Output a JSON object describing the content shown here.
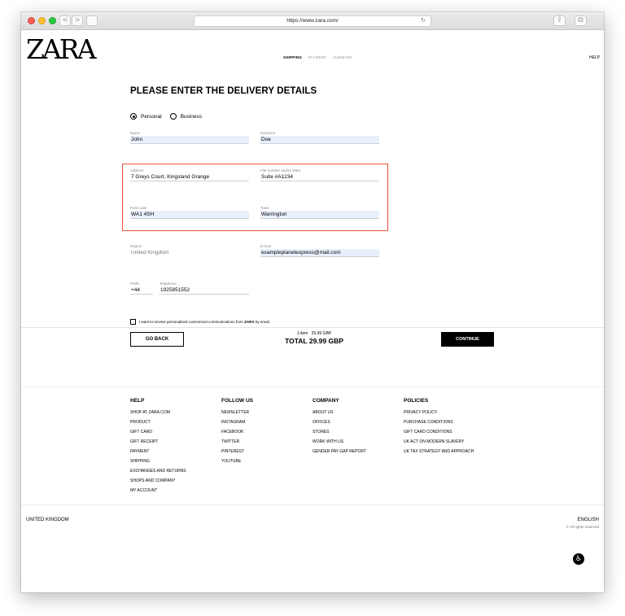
{
  "browser": {
    "url": "https://www.zara.com/",
    "back_icon": "<",
    "forward_icon": ">",
    "reload_icon": "↻",
    "share_icon": "⇪",
    "tabs_icon": "⧉"
  },
  "header": {
    "logo": "ZARA",
    "steps": [
      "SHIPPING",
      "PAYMENT",
      "SUMMARY"
    ],
    "step_separator": "-",
    "help": "HELP"
  },
  "form": {
    "title": "PLEASE ENTER THE DELIVERY DETAILS",
    "customer_types": [
      "Personal",
      "Business"
    ],
    "selected_type": "Personal",
    "name": {
      "label": "Name",
      "value": "John"
    },
    "surname": {
      "label": "Surname",
      "value": "Doe"
    },
    "address": {
      "label": "Address",
      "value": "7 Greys Court, Kingsland Grange"
    },
    "flat": {
      "label": "Flat number and/or letter",
      "value": "Suite #A1234"
    },
    "postcode": {
      "label": "Post code",
      "value": "WA1 4SH"
    },
    "town": {
      "label": "Town",
      "value": "Warrington"
    },
    "region": {
      "label": "Region",
      "value": "United Kingdom"
    },
    "email": {
      "label": "E-mail",
      "value": "exampleplanetexpress@mail.com"
    },
    "prefix": {
      "label": "Prefix",
      "value": "+44"
    },
    "telephone": {
      "label": "Telephone",
      "value": "1925851552"
    },
    "marketing_text": "I want to receive personalised commercial communications from",
    "marketing_brand": "ZARA",
    "marketing_suffix": "by email."
  },
  "order": {
    "items": "1 item",
    "items_price": "29.99 GBP",
    "total_label": "TOTAL",
    "total": "29.99 GBP",
    "go_back": "GO BACK",
    "continue": "CONTINUE"
  },
  "footer": {
    "columns": [
      {
        "title": "HELP",
        "links": [
          "SHOP AT ZARA.COM",
          "PRODUCT",
          "GIFT CARD",
          "GIFT RECEIPT",
          "PAYMENT",
          "SHIPPING",
          "EXCHANGES AND RETURNS",
          "SHOPS AND COMPANY",
          "MY ACCOUNT"
        ]
      },
      {
        "title": "FOLLOW US",
        "links": [
          "NEWSLETTER",
          "INSTAGRAM",
          "FACEBOOK",
          "TWITTER",
          "PINTEREST",
          "YOUTUBE"
        ]
      },
      {
        "title": "COMPANY",
        "links": [
          "ABOUT US",
          "OFFICES",
          "STORES",
          "WORK WITH US",
          "GENDER PAY GAP REPORT"
        ]
      },
      {
        "title": "POLICIES",
        "links": [
          "PRIVACY POLICY",
          "PURCHASE CONDITIONS",
          "GIFT CARD CONDITIONS",
          "UK ACT ON MODERN SLAVERY",
          "UK TAX STRATEGY AND APPROACH"
        ]
      }
    ],
    "country": "UNITED KINGDOM",
    "language": "ENGLISH",
    "rights": "© All rights reserved"
  },
  "colors": {
    "highlight": "#e8523b",
    "autofill": "#e9f0fd"
  },
  "icons": {
    "accessibility": "accessibility-icon"
  }
}
